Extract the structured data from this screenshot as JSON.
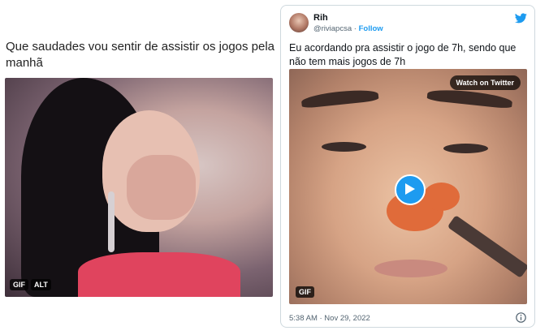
{
  "left_meme": {
    "caption": "Que saudades vou sentir de assistir os jogos pela manhã",
    "badges": [
      "GIF",
      "ALT"
    ]
  },
  "tweet": {
    "name": "Rih",
    "handle": "@riviapcsa",
    "separator": "·",
    "follow_label": "Follow",
    "text": "Eu acordando pra assistir o jogo de 7h, sendo que não tem mais jogos de 7h",
    "watch_label": "Watch on Twitter",
    "gif_badge": "GIF",
    "timestamp": "5:38 AM · Nov 29, 2022"
  },
  "colors": {
    "accent": "#1d9bf0",
    "muted_text": "#536471",
    "border": "#cfd9de"
  },
  "icons": [
    "twitter-bird-icon",
    "play-icon",
    "info-icon"
  ]
}
